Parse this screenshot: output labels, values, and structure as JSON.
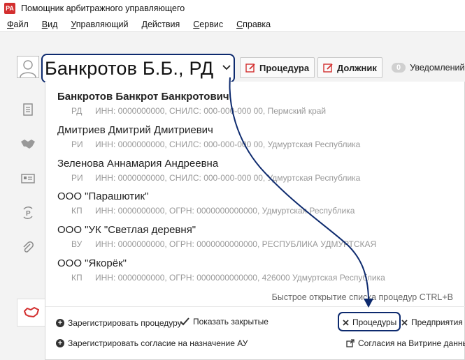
{
  "window": {
    "title": "Помощник арбитражного управляющего",
    "icon_label": "PA"
  },
  "menu": [
    {
      "label": "Файл",
      "mn": "Ф",
      "rest": "айл"
    },
    {
      "label": "Вид",
      "mn": "В",
      "rest": "ид"
    },
    {
      "label": "Управляющий",
      "mn": "У",
      "rest": "правляющий"
    },
    {
      "label": "Действия",
      "mn": "Д",
      "rest": "ействия"
    },
    {
      "label": "Сервис",
      "mn": "С",
      "rest": "ервис"
    },
    {
      "label": "Справка",
      "mn": "С",
      "rest": "правка"
    }
  ],
  "selector": {
    "value": "Банкротов Б.Б., РД"
  },
  "toolbar": {
    "procedure_label": "Процедура",
    "debtor_label": "Должник",
    "notifications_count": "0",
    "notifications_label": "Уведомлений"
  },
  "debtors": [
    {
      "name": "Банкротов Банкрот Банкротович",
      "type": "РД",
      "details": "ИНН: 0000000000, СНИЛС: 000-000-000 00, Пермский край",
      "bold": true
    },
    {
      "name": "Дмитриев Дмитрий Дмитриевич",
      "type": "РИ",
      "details": "ИНН: 0000000000, СНИЛС: 000-000-000 00, Удмуртская Республика"
    },
    {
      "name": "Зеленова Аннамария Андреевна",
      "type": "РИ",
      "details": "ИНН: 0000000000, СНИЛС: 000-000-000 00, Удмуртская Республика"
    },
    {
      "name": "ООО \"Парашютик\"",
      "type": "КП",
      "details": "ИНН: 0000000000, ОГРН: 0000000000000, Удмуртская Республика"
    },
    {
      "name": "ООО \"УК \"Светлая деревня\"",
      "type": "ВУ",
      "details": "ИНН: 0000000000, ОГРН: 0000000000000, РЕСПУБЛИКА УДМУРТСКАЯ"
    },
    {
      "name": "ООО \"Якорёк\"",
      "type": "КП",
      "details": "ИНН: 0000000000, ОГРН: 0000000000000, 426000 Удмуртская Республика"
    }
  ],
  "hint": "Быстрое открытие списка процедур CTRL+B",
  "actions": {
    "register_procedure": "Зарегистрировать процедуру",
    "show_closed": "Показать закрытые",
    "procedures": "Процедуры",
    "enterprises": "Предприятия",
    "register_consent": "Зарегистрировать согласие на назначение АУ",
    "showcase_consents": "Согласия на Витрине данных"
  },
  "colors": {
    "highlight": "#0d2a6e",
    "accent_red": "#d32f2f"
  }
}
